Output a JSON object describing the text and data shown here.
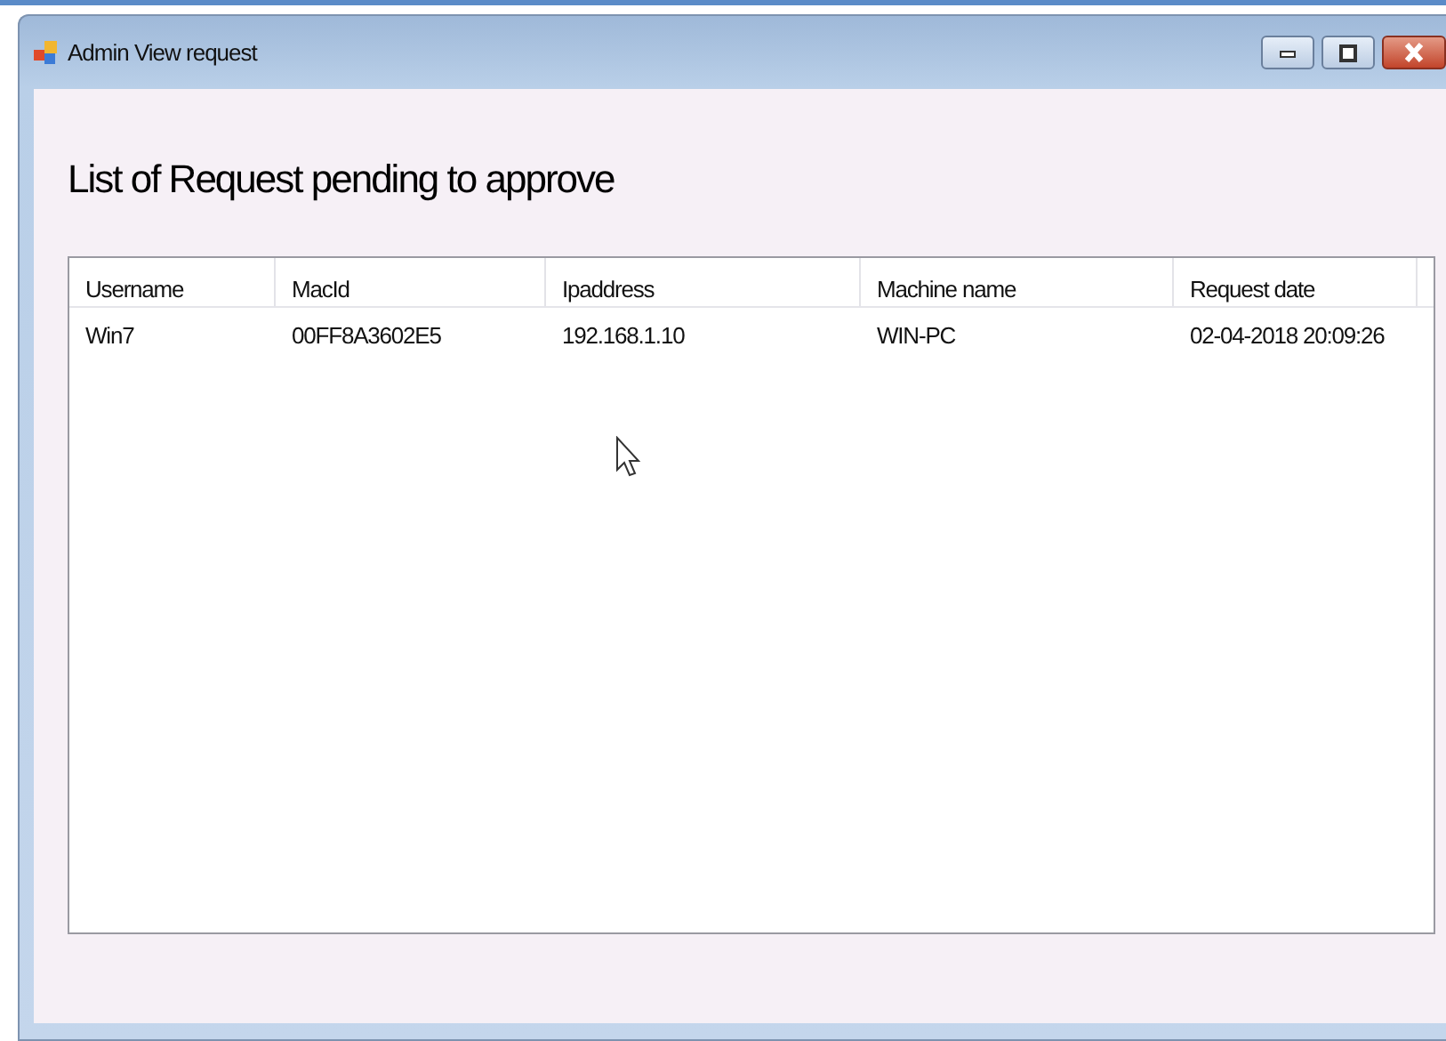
{
  "window": {
    "title": "Admin View request"
  },
  "heading": "List of Request pending to approve",
  "table": {
    "columns": [
      "Username",
      "MacId",
      "Ipaddress",
      "Machine name",
      "Request date"
    ],
    "rows": [
      [
        "Win7",
        "00FF8A3602E5",
        "192.168.1.10",
        "WIN-PC",
        "02-04-2018 20:09:26"
      ]
    ]
  }
}
